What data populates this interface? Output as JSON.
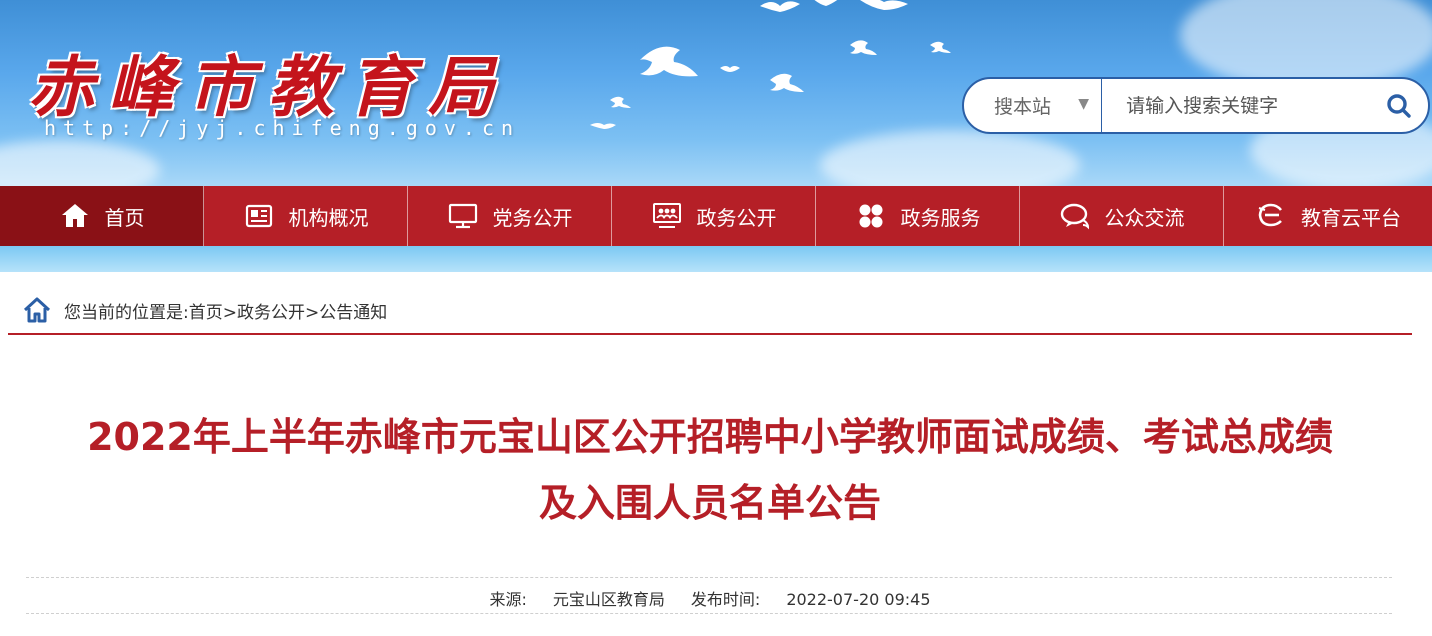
{
  "header": {
    "site_title": "赤峰市教育局",
    "site_url": "http://jyj.chifeng.gov.cn"
  },
  "search": {
    "scope": "搜本站",
    "placeholder": "请输入搜索关键字"
  },
  "nav": {
    "items": [
      {
        "label": "首页",
        "icon": "home-icon",
        "active": true
      },
      {
        "label": "机构概况",
        "icon": "newspaper-icon"
      },
      {
        "label": "党务公开",
        "icon": "monitor-icon"
      },
      {
        "label": "政务公开",
        "icon": "meeting-icon"
      },
      {
        "label": "政务服务",
        "icon": "grid-icon"
      },
      {
        "label": "公众交流",
        "icon": "chat-icon"
      },
      {
        "label": "教育云平台",
        "icon": "cloud-e-icon"
      }
    ]
  },
  "breadcrumb": {
    "prefix": "您当前的位置是:",
    "items": [
      "首页",
      "政务公开",
      "公告通知"
    ],
    "separator": ">"
  },
  "article": {
    "title_line1": "2022年上半年赤峰市元宝山区公开招聘中小学教师面试成绩、考试总成绩",
    "title_line2": "及入围人员名单公告",
    "source_label": "来源:",
    "source": "元宝山区教育局",
    "time_label": "发布时间:",
    "time": "2022-07-20 09:45"
  },
  "colors": {
    "accent_red": "#b51f27",
    "nav_active": "#8a1116",
    "search_border": "#2b5fa6"
  }
}
